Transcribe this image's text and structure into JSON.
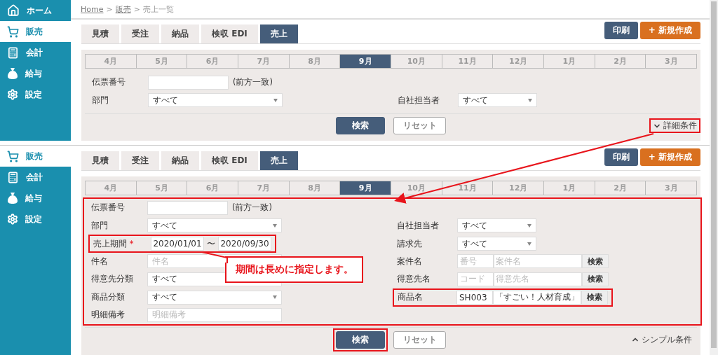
{
  "screens": [
    {
      "sidebar": {
        "items": [
          {
            "label": "ホーム",
            "selected": false
          },
          {
            "label": "販売",
            "selected": true
          },
          {
            "label": "会計",
            "selected": false
          },
          {
            "label": "給与",
            "selected": false
          },
          {
            "label": "設定",
            "selected": false
          }
        ]
      },
      "breadcrumb": [
        {
          "label": "Home",
          "link": true
        },
        {
          "label": ">",
          "link": false
        },
        {
          "label": "販売",
          "link": true
        },
        {
          "label": ">",
          "link": false
        },
        {
          "label": "売上一覧",
          "link": false
        }
      ],
      "tabs": [
        {
          "label": "見積",
          "selected": false
        },
        {
          "label": "受注",
          "selected": false
        },
        {
          "label": "納品",
          "selected": false
        },
        {
          "label": "検収 EDI",
          "selected": false
        },
        {
          "label": "売上",
          "selected": true
        }
      ],
      "actions": [
        {
          "label": "印刷",
          "kind": "dark"
        },
        {
          "label": "+ 新規作成",
          "kind": "orange"
        }
      ],
      "months": [
        {
          "label": "4月",
          "selected": false
        },
        {
          "label": "5月",
          "selected": false
        },
        {
          "label": "6月",
          "selected": false
        },
        {
          "label": "7月",
          "selected": false
        },
        {
          "label": "8月",
          "selected": false
        },
        {
          "label": "9月",
          "selected": true
        },
        {
          "label": "10月",
          "selected": false
        },
        {
          "label": "11月",
          "selected": false
        },
        {
          "label": "12月",
          "selected": false
        },
        {
          "label": "1月",
          "selected": false
        },
        {
          "label": "2月",
          "selected": false
        },
        {
          "label": "3月",
          "selected": false
        }
      ],
      "form": {
        "highlighted": false,
        "rows": [
          {
            "left": {
              "label": "伝票番号",
              "kind": "text",
              "note": "(前方一致)",
              "highlighted": false
            }
          },
          {
            "left": {
              "label": "部門",
              "kind": "select",
              "value": "すべて",
              "highlighted": false
            },
            "right": {
              "label": "自社担当者",
              "kind": "select",
              "value": "すべて",
              "highlighted": false
            }
          }
        ]
      },
      "buttons": [
        {
          "label": "検索",
          "kind": "primary",
          "highlighted": false
        },
        {
          "label": "リセット",
          "kind": "plain",
          "highlighted": false
        }
      ],
      "toggle": {
        "label": "詳細条件",
        "expanded": false,
        "highlighted": true
      }
    },
    {
      "sidebar": {
        "items": [
          {
            "label": "販売",
            "selected": true
          },
          {
            "label": "会計",
            "selected": false
          },
          {
            "label": "給与",
            "selected": false
          },
          {
            "label": "設定",
            "selected": false
          }
        ]
      },
      "tabs": [
        {
          "label": "見積",
          "selected": false
        },
        {
          "label": "受注",
          "selected": false
        },
        {
          "label": "納品",
          "selected": false
        },
        {
          "label": "検収 EDI",
          "selected": false
        },
        {
          "label": "売上",
          "selected": true
        }
      ],
      "actions": [
        {
          "label": "印刷",
          "kind": "dark"
        },
        {
          "label": "+ 新規作成",
          "kind": "orange"
        }
      ],
      "months": [
        {
          "label": "4月",
          "selected": false
        },
        {
          "label": "5月",
          "selected": false
        },
        {
          "label": "6月",
          "selected": false
        },
        {
          "label": "7月",
          "selected": false
        },
        {
          "label": "8月",
          "selected": false
        },
        {
          "label": "9月",
          "selected": true
        },
        {
          "label": "10月",
          "selected": false
        },
        {
          "label": "11月",
          "selected": false
        },
        {
          "label": "12月",
          "selected": false
        },
        {
          "label": "1月",
          "selected": false
        },
        {
          "label": "2月",
          "selected": false
        },
        {
          "label": "3月",
          "selected": false
        }
      ],
      "form": {
        "highlighted": true,
        "rows": [
          {
            "left": {
              "label": "伝票番号",
              "kind": "text",
              "note": "(前方一致)",
              "highlighted": false
            }
          },
          {
            "left": {
              "label": "部門",
              "kind": "select",
              "value": "すべて",
              "highlighted": false
            },
            "right": {
              "label": "自社担当者",
              "kind": "select",
              "value": "すべて",
              "highlighted": false
            }
          },
          {
            "left": {
              "label": "売上期間",
              "kind": "range",
              "required_mark": "*",
              "from": "2020/01/01",
              "separator": "〜",
              "to": "2020/09/30",
              "highlighted": true,
              "callout": "期間は長めに指定します。"
            },
            "right": {
              "label": "請求先",
              "kind": "select",
              "value": "すべて",
              "highlighted": false
            }
          },
          {
            "left": {
              "label": "件名",
              "kind": "text",
              "placeholder": "件名",
              "highlighted": false
            },
            "right": {
              "label": "案件名",
              "kind": "code-name",
              "code_placeholder": "番号",
              "name_placeholder": "案件名",
              "button": "検索",
              "highlighted": false
            }
          },
          {
            "left": {
              "label": "得意先分類",
              "kind": "select",
              "value": "すべて",
              "highlighted": false
            },
            "right": {
              "label": "得意先名",
              "kind": "code-name",
              "code_placeholder": "コード",
              "name_placeholder": "得意先名",
              "button": "検索",
              "highlighted": false
            }
          },
          {
            "left": {
              "label": "商品分類",
              "kind": "select",
              "value": "すべて",
              "highlighted": false
            },
            "right": {
              "label": "商品名",
              "kind": "code-name",
              "code": "SH003",
              "name": "「すごい！人材育成」",
              "button": "検索",
              "highlighted": true
            }
          },
          {
            "left": {
              "label": "明細備考",
              "kind": "text",
              "placeholder": "明細備考",
              "highlighted": false
            }
          }
        ]
      },
      "buttons": [
        {
          "label": "検索",
          "kind": "primary",
          "highlighted": true
        },
        {
          "label": "リセット",
          "kind": "plain",
          "highlighted": false
        }
      ],
      "toggle": {
        "label": "シンプル条件",
        "expanded": true,
        "highlighted": false
      }
    }
  ]
}
